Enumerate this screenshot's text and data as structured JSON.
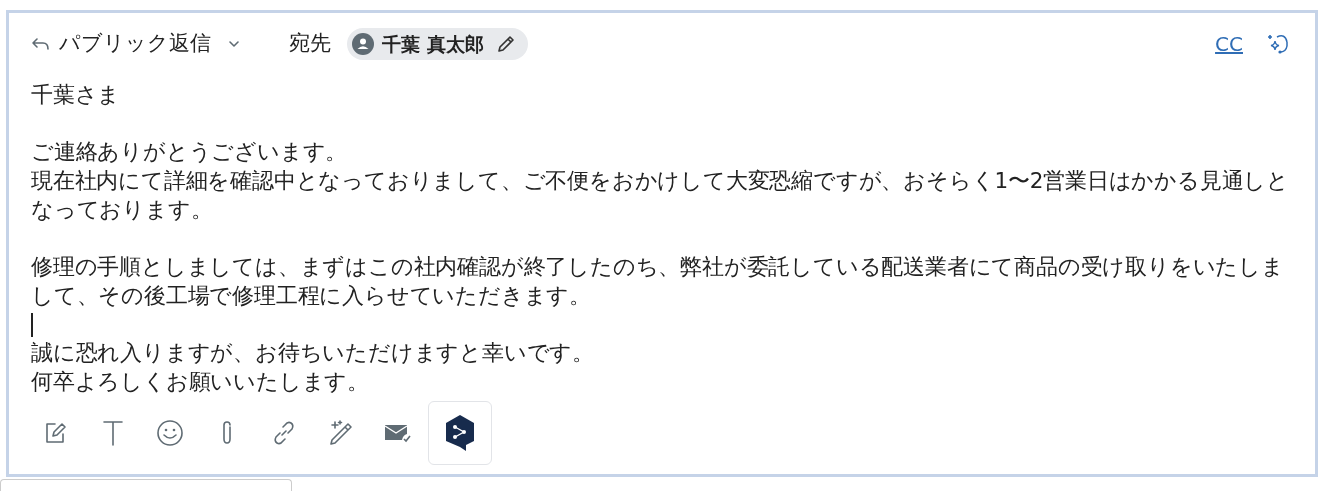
{
  "header": {
    "reply_mode": "パブリック返信",
    "to_label": "宛先",
    "recipient": "千葉 真太郎",
    "cc": "CC"
  },
  "blocks": [
    {
      "kind": "text",
      "lines": [
        "千葉さま"
      ]
    },
    {
      "kind": "text",
      "lines": [
        "ご連絡ありがとうございます。",
        "現在社内にて詳細を確認中となっておりまして、ご不便をおかけして大変恐縮ですが、おそらく1〜2営業日はかかる見通しと",
        "なっております。"
      ]
    },
    {
      "kind": "text",
      "lines": [
        "修理の手順としましては、まずはこの社内確認が終了したのち、弊社が委託している配送業者にて商品の受け取りをいたしま",
        "して、その後工場で修理工程に入らせていただきます。"
      ]
    },
    {
      "kind": "caret"
    },
    {
      "kind": "text",
      "lines": [
        "誠に恐れ入りますが、お待ちいただけますと幸いです。",
        "何卒よろしくお願いいたします。"
      ]
    }
  ],
  "toolbar": [
    {
      "kind": "compose"
    },
    {
      "kind": "text"
    },
    {
      "kind": "emoji"
    },
    {
      "kind": "attach"
    },
    {
      "kind": "link"
    },
    {
      "kind": "magic"
    },
    {
      "kind": "mail"
    },
    {
      "kind": "app"
    }
  ]
}
